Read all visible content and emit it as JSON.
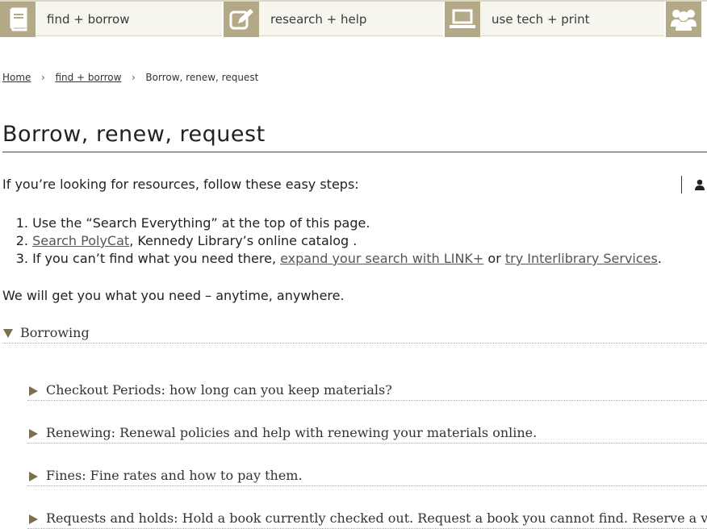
{
  "topnav": {
    "tabs": [
      {
        "label": "find + borrow",
        "icon": "book-icon"
      },
      {
        "label": "research + help",
        "icon": "edit-icon"
      },
      {
        "label": "use tech + print",
        "icon": "laptop-icon"
      },
      {
        "label": "",
        "icon": "group-icon"
      }
    ],
    "accent": "#b4a986"
  },
  "breadcrumb": {
    "home": "Home",
    "parent": "find + borrow",
    "current": "Borrow, renew, request",
    "separator": "›"
  },
  "page": {
    "title": "Borrow, renew, request",
    "intro": "If you’re looking for resources, follow these easy steps:",
    "steps": [
      {
        "num": "1.",
        "text_before": "Use the “Search Everything” at the top of this page."
      },
      {
        "num": "2.",
        "link": "Search PolyCat",
        "text_after": ", Kennedy Library’s online catalog ."
      },
      {
        "num": "3.",
        "text_before": "If you can’t find what you need there, ",
        "link1": "expand your search with LINK+",
        "between": " or ",
        "link2": "try Interlibrary Services",
        "text_after": "."
      }
    ],
    "closing": "We will get you what you need – anytime, anywhere."
  },
  "accordion": {
    "heading": "Borrowing",
    "items": [
      "Checkout Periods: how long can you keep materials?",
      "Renewing: Renewal policies and help with renewing your materials online.",
      "Fines: Fine rates and how to pay them.",
      "Requests and holds: Hold a book currently checked out. Request a book you cannot find. Reserve a video fo"
    ]
  }
}
